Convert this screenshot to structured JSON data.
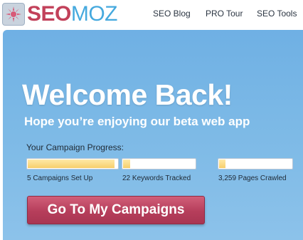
{
  "brand": {
    "seo": "SEO",
    "moz": "MOZ",
    "colors": {
      "seo": "#c2415a",
      "moz": "#45a9de"
    }
  },
  "nav": {
    "items": [
      "SEO Blog",
      "PRO Tour",
      "SEO Tools"
    ]
  },
  "hero": {
    "title": "Welcome Back!",
    "subtitle": "Hope you’re enjoying our beta web app",
    "progress_label": "Your Campaign Progress:",
    "meters": [
      {
        "label": "5 Campaigns Set Up",
        "fill_fraction": 0.97
      },
      {
        "label": "22 Keywords Tracked",
        "fill_fraction": 0.1
      },
      {
        "label": "3,259 Pages Crawled",
        "fill_fraction": 0.09
      }
    ],
    "cta_label": "Go To My Campaigns"
  }
}
